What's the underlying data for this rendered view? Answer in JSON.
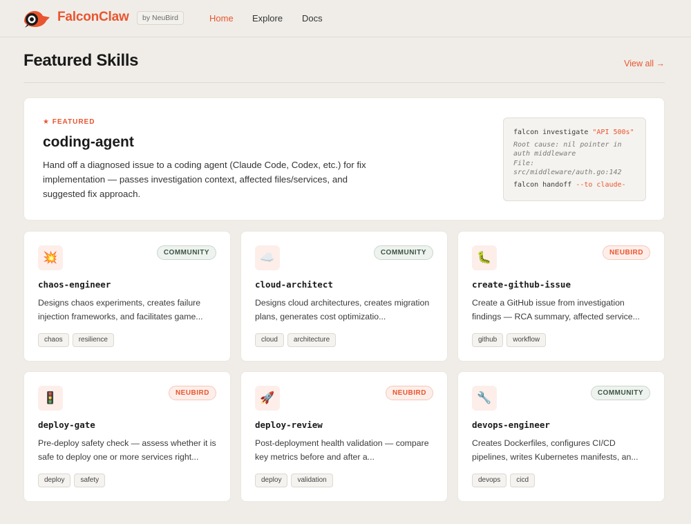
{
  "header": {
    "brand": "FalconClaw",
    "by_badge": "by NeuBird",
    "nav": [
      {
        "label": "Home",
        "active": true
      },
      {
        "label": "Explore",
        "active": false
      },
      {
        "label": "Docs",
        "active": false
      }
    ]
  },
  "section": {
    "title": "Featured Skills",
    "view_all": "View all →"
  },
  "featured": {
    "label": "★ FEATURED",
    "name": "coding-agent",
    "description": "Hand off a diagnosed issue to a coding agent (Claude Code, Codex, etc.) for fix implementation — passes investigation context, affected files/services, and suggested fix approach.",
    "terminal": {
      "cmd1": "falcon investigate ",
      "cmd1_arg": "\"API 500s\"",
      "comment1": "Root cause: nil pointer in auth middleware",
      "comment2": "File: src/middleware/auth.go:142",
      "cmd2": "falcon handoff ",
      "cmd2_arg": "--to claude-"
    }
  },
  "cards": [
    {
      "name": "chaos-engineer",
      "icon": "💥",
      "icon_name": "explosion-icon",
      "badge": "COMMUNITY",
      "badge_type": "community",
      "description": "Designs chaos experiments, creates failure injection frameworks, and facilitates game...",
      "tags": [
        "chaos",
        "resilience"
      ]
    },
    {
      "name": "cloud-architect",
      "icon": "☁️",
      "icon_name": "cloud-icon",
      "badge": "COMMUNITY",
      "badge_type": "community",
      "description": "Designs cloud architectures, creates migration plans, generates cost optimizatio...",
      "tags": [
        "cloud",
        "architecture"
      ]
    },
    {
      "name": "create-github-issue",
      "icon": "🐛",
      "icon_name": "bug-icon",
      "badge": "NEUBIRD",
      "badge_type": "neubird",
      "description": "Create a GitHub issue from investigation findings — RCA summary, affected service...",
      "tags": [
        "github",
        "workflow"
      ]
    },
    {
      "name": "deploy-gate",
      "icon": "🚦",
      "icon_name": "traffic-light-icon",
      "badge": "NEUBIRD",
      "badge_type": "neubird",
      "description": "Pre-deploy safety check — assess whether it is safe to deploy one or more services right...",
      "tags": [
        "deploy",
        "safety"
      ]
    },
    {
      "name": "deploy-review",
      "icon": "🚀",
      "icon_name": "rocket-icon",
      "badge": "NEUBIRD",
      "badge_type": "neubird",
      "description": "Post-deployment health validation — compare key metrics before and after a...",
      "tags": [
        "deploy",
        "validation"
      ]
    },
    {
      "name": "devops-engineer",
      "icon": "🔧",
      "icon_name": "wrench-icon",
      "badge": "COMMUNITY",
      "badge_type": "community",
      "description": "Creates Dockerfiles, configures CI/CD pipelines, writes Kubernetes manifests, an...",
      "tags": [
        "devops",
        "cicd"
      ]
    }
  ]
}
